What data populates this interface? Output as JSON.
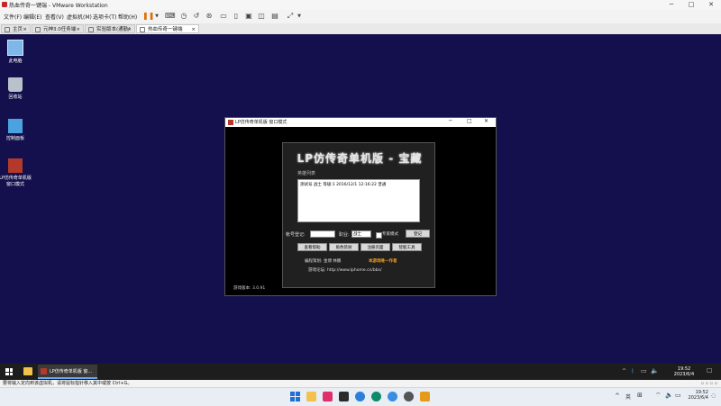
{
  "window": {
    "title": "热血传奇一键端 - VMware Workstation"
  },
  "menu": [
    "文件(F)",
    "编辑(E)",
    "查看(V)",
    "虚拟机(M)",
    "选项卡(T)",
    "帮助(H)"
  ],
  "tabs": [
    {
      "label": "主页"
    },
    {
      "label": "元神3.0任务端"
    },
    {
      "label": "实验版本(通勤/外包)"
    },
    {
      "label": "热血传奇一键端"
    }
  ],
  "desktop_icons": [
    {
      "label": "此电脑",
      "icon": "computer-icon"
    },
    {
      "label": "回收站",
      "icon": "recycle-bin-icon"
    },
    {
      "label": "控制面板",
      "icon": "control-panel-icon"
    },
    {
      "label": "LP仿传奇单机版 窗口模式",
      "icon": "game-icon"
    }
  ],
  "game": {
    "window_title": "LP仿传奇单机版 窗口模式",
    "title": "LP仿传奇单机版 - 宝藏",
    "roles_label": "英雄列表",
    "role_row": "测试号    战士 等级:1  2016/12/1 12:16:22  普通",
    "account_label": "帐号登记:",
    "account_value": "",
    "class_label": "职业:",
    "class_value": "战士",
    "expert_label": "专家模式",
    "register_button": "登记",
    "buttons": [
      "查看帮助",
      "角色装扮",
      "注册页面",
      "智能工具"
    ],
    "credits": "编程策划: 金博 林鹏",
    "author": "本游戏唯一作者",
    "forum": "游戏论坛: http://www.lphome.cn/bbs/",
    "version": "游戏版本: 3.0.91"
  },
  "guest_taskbar": {
    "app_label": "LP仿传奇单机版 窗...",
    "time": "19:52",
    "date": "2023/6/4"
  },
  "vm_status": "要将输入定向到该虚拟机，请将鼠标指针移入其中或按 Ctrl+G。",
  "host_taskbar": {
    "lang": "英",
    "time": "19:52",
    "date": "2023/6/4"
  },
  "colors": {
    "desktop": "#14104d",
    "accent": "#e06c00"
  }
}
